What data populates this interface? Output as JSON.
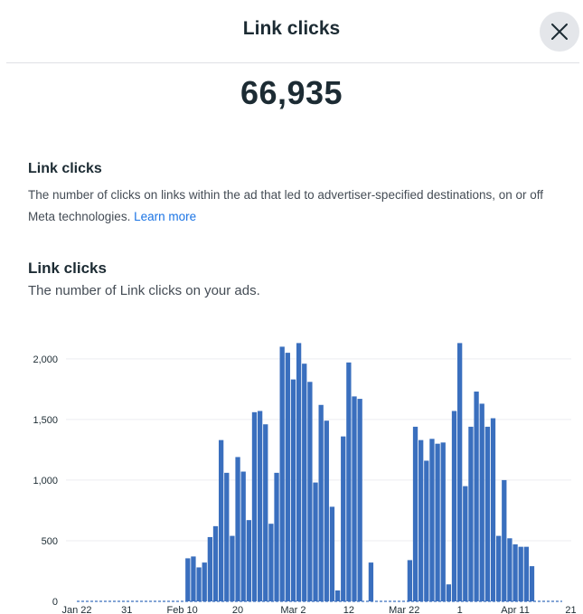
{
  "header": {
    "title": "Link clicks",
    "close_icon": "close-icon"
  },
  "summary": {
    "total": "66,935"
  },
  "definition": {
    "title": "Link clicks",
    "text": "The number of clicks on links within the ad that led to advertiser-specified destinations, on or off Meta technologies.",
    "link_label": "Learn more"
  },
  "chart_section": {
    "title": "Link clicks",
    "subtitle": "The number of Link clicks on your ads."
  },
  "chart_data": {
    "type": "bar",
    "title": "",
    "xlabel": "",
    "ylabel": "",
    "ylim": [
      0,
      2200
    ],
    "yticks": [
      0,
      500,
      1000,
      1500,
      2000
    ],
    "ytick_labels": [
      "0",
      "500",
      "1,000",
      "1,500",
      "2,000"
    ],
    "xtick_labels": [
      {
        "day": 0,
        "label": "Jan 22"
      },
      {
        "day": 9,
        "label": "31"
      },
      {
        "day": 19,
        "label": "Feb 10"
      },
      {
        "day": 29,
        "label": "20"
      },
      {
        "day": 39,
        "label": "Mar 2"
      },
      {
        "day": 49,
        "label": "12"
      },
      {
        "day": 59,
        "label": "Mar 22"
      },
      {
        "day": 69,
        "label": "1"
      },
      {
        "day": 79,
        "label": "Apr 11"
      },
      {
        "day": 89,
        "label": "21"
      }
    ],
    "grid": true,
    "bar_color": "#3a6fbe",
    "start_date": "Jan 22",
    "values": [
      0,
      0,
      0,
      0,
      0,
      0,
      0,
      0,
      0,
      0,
      0,
      0,
      0,
      0,
      0,
      0,
      0,
      0,
      0,
      0,
      355,
      370,
      280,
      320,
      530,
      620,
      1330,
      1060,
      540,
      1190,
      1070,
      670,
      1560,
      1570,
      1460,
      640,
      1060,
      2100,
      2050,
      1830,
      2130,
      1960,
      1810,
      980,
      1620,
      1490,
      780,
      90,
      1360,
      1970,
      1690,
      1670,
      0,
      320,
      0,
      0,
      0,
      0,
      0,
      0,
      340,
      1440,
      1330,
      1160,
      1340,
      1300,
      1310,
      140,
      1570,
      2130,
      950,
      1440,
      1730,
      1630,
      1440,
      1510,
      540,
      1000,
      520,
      470,
      450,
      450,
      290,
      0,
      0,
      0,
      0,
      0,
      0,
      0
    ]
  }
}
